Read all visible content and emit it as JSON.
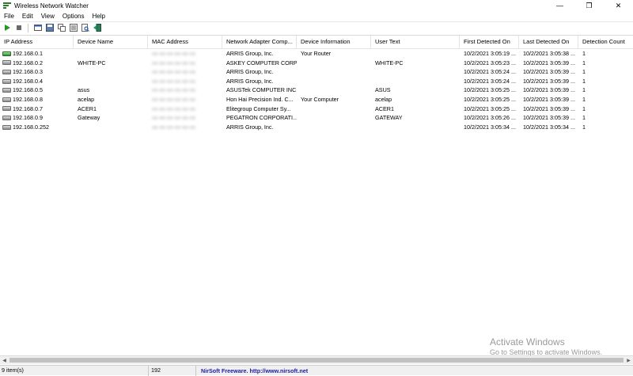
{
  "window": {
    "title": "Wireless Network Watcher",
    "app_icon": "network-app-icon",
    "buttons": {
      "minimize": "—",
      "maximize": "❐",
      "close": "✕"
    }
  },
  "menu": [
    "File",
    "Edit",
    "View",
    "Options",
    "Help"
  ],
  "toolbar": {
    "icons": [
      "play-icon",
      "stop-icon",
      "html-report-icon",
      "save-icon",
      "copy-icon",
      "properties-icon",
      "find-icon",
      "exit-icon"
    ]
  },
  "columns": [
    "IP Address",
    "Device Name",
    "MAC Address",
    "Network Adapter Comp...",
    "Device Information",
    "User Text",
    "First Detected On",
    "Last Detected On",
    "Detection Count"
  ],
  "rows": [
    {
      "ip": "192.168.0.1",
      "name": "",
      "mac": "xx-xx-xx-xx-xx-xx",
      "vendor": "ARRIS Group, Inc.",
      "info": "Your Router",
      "user": "",
      "first": "10/2/2021 3:05:19 ...",
      "last": "10/2/2021 3:05:38 ...",
      "count": "1"
    },
    {
      "ip": "192.168.0.2",
      "name": "WHITE-PC",
      "mac": "xx-xx-xx-xx-xx-xx",
      "vendor": "ASKEY COMPUTER CORP",
      "info": "",
      "user": "WHITE-PC",
      "first": "10/2/2021 3:05:23 ...",
      "last": "10/2/2021 3:05:39 ...",
      "count": "1"
    },
    {
      "ip": "192.168.0.3",
      "name": "",
      "mac": "xx-xx-xx-xx-xx-xx",
      "vendor": "ARRIS Group, Inc.",
      "info": "",
      "user": "",
      "first": "10/2/2021 3:05:24 ...",
      "last": "10/2/2021 3:05:39 ...",
      "count": "1"
    },
    {
      "ip": "192.168.0.4",
      "name": "",
      "mac": "xx-xx-xx-xx-xx-xx",
      "vendor": "ARRIS Group, Inc.",
      "info": "",
      "user": "",
      "first": "10/2/2021 3:05:24 ...",
      "last": "10/2/2021 3:05:39 ...",
      "count": "1"
    },
    {
      "ip": "192.168.0.5",
      "name": "asus",
      "mac": "xx-xx-xx-xx-xx-xx",
      "vendor": "ASUSTek COMPUTER INC.",
      "info": "",
      "user": "ASUS",
      "first": "10/2/2021 3:05:25 ...",
      "last": "10/2/2021 3:05:39 ...",
      "count": "1"
    },
    {
      "ip": "192.168.0.8",
      "name": "acelap",
      "mac": "xx-xx-xx-xx-xx-xx",
      "vendor": "Hon Hai Precision Ind. C...",
      "info": "Your Computer",
      "user": "acelap",
      "first": "10/2/2021 3:05:25 ...",
      "last": "10/2/2021 3:05:39 ...",
      "count": "1"
    },
    {
      "ip": "192.168.0.7",
      "name": "ACER1",
      "mac": "xx-xx-xx-xx-xx-xx",
      "vendor": "Elitegroup Computer Sy...",
      "info": "",
      "user": "ACER1",
      "first": "10/2/2021 3:05:25 ...",
      "last": "10/2/2021 3:05:39 ...",
      "count": "1"
    },
    {
      "ip": "192.168.0.9",
      "name": "Gateway",
      "mac": "xx-xx-xx-xx-xx-xx",
      "vendor": "PEGATRON CORPORATI...",
      "info": "",
      "user": "GATEWAY",
      "first": "10/2/2021 3:05:26 ...",
      "last": "10/2/2021 3:05:39 ...",
      "count": "1"
    },
    {
      "ip": "192.168.0.252",
      "name": "",
      "mac": "xx-xx-xx-xx-xx-xx",
      "vendor": "ARRIS Group, Inc.",
      "info": "",
      "user": "",
      "first": "10/2/2021 3:05:34 ...",
      "last": "10/2/2021 3:05:34 ...",
      "count": "1"
    }
  ],
  "status": {
    "items": "9 item(s)",
    "extra": "192",
    "link": "NirSoft Freeware.  http://www.nirsoft.net"
  },
  "watermark": {
    "line1": "Activate Windows",
    "line2": "Go to Settings to activate Windows."
  },
  "colors": {
    "accent_green": "#2d7a2d",
    "link_blue": "#1a1aa8"
  }
}
